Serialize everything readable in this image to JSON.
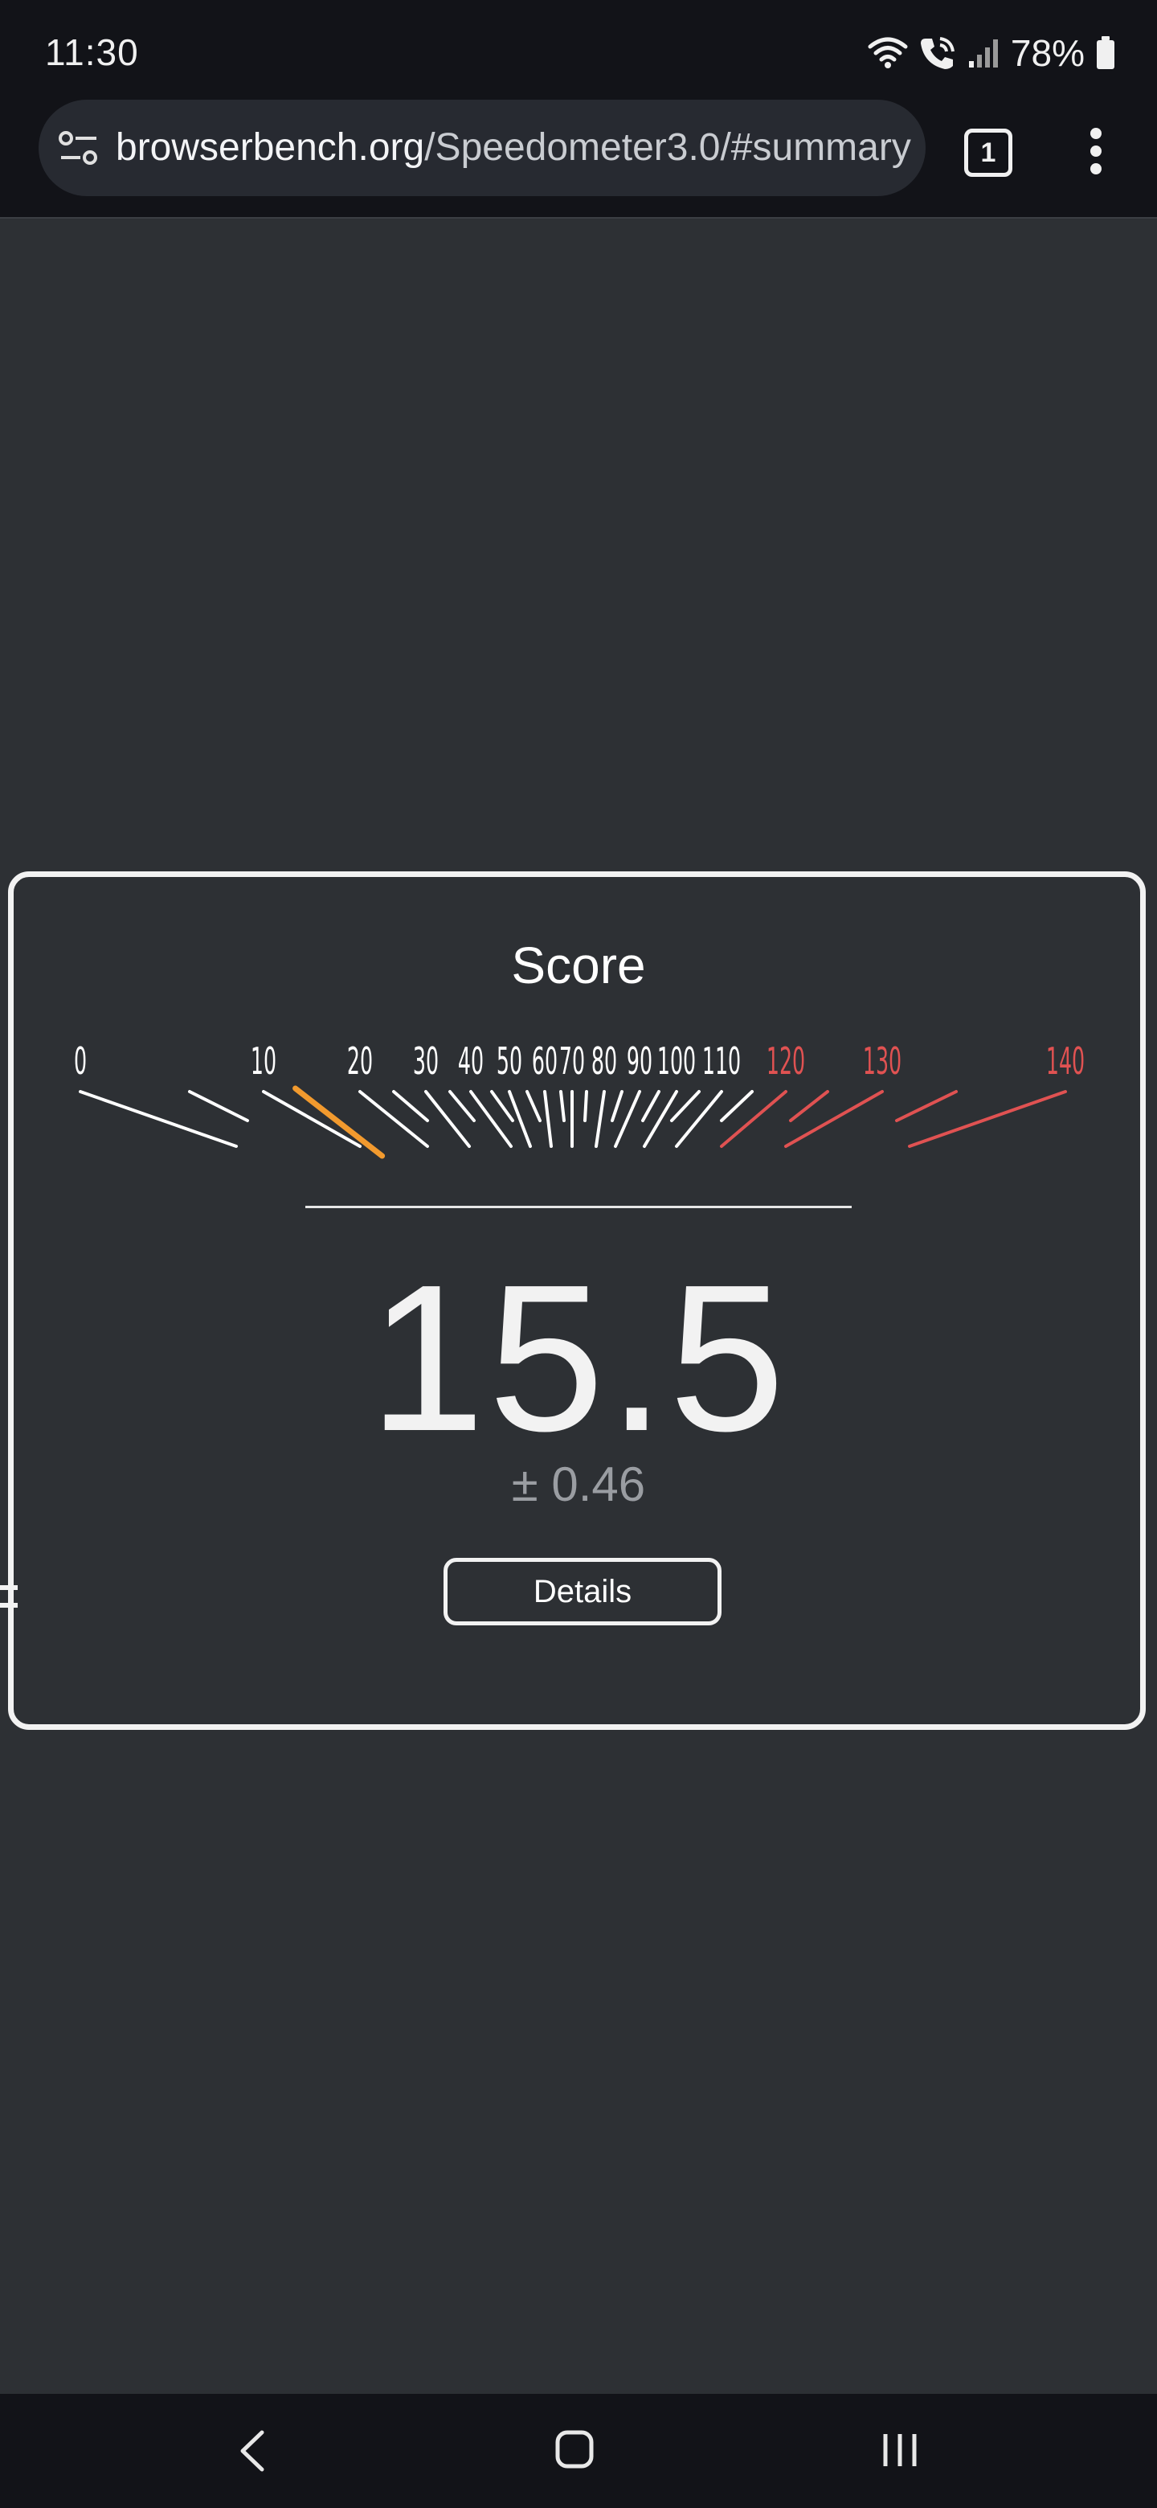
{
  "status_bar": {
    "time": "11:30",
    "battery": "78%",
    "icons": [
      "wifi-icon",
      "wifi-calling-icon",
      "signal-icon",
      "battery-icon"
    ]
  },
  "browser": {
    "url_host": "browserbench.org",
    "url_path": "/Speedometer3.0/#summary",
    "tab_count": "1",
    "icons": [
      "site-info-icon",
      "tab-switcher-icon",
      "menu-dots-icon"
    ]
  },
  "score_card": {
    "title": "Score",
    "score": "15.5",
    "error": "± 0.46",
    "details_label": "Details"
  },
  "gauge": {
    "needle_value": 15.5,
    "tick_labels": [
      {
        "text": "0",
        "color": "#ffffff"
      },
      {
        "text": "10",
        "color": "#ffffff"
      },
      {
        "text": "20",
        "color": "#ffffff"
      },
      {
        "text": "30",
        "color": "#ffffff"
      },
      {
        "text": "40",
        "color": "#ffffff"
      },
      {
        "text": "50",
        "color": "#ffffff"
      },
      {
        "text": "60",
        "color": "#ffffff"
      },
      {
        "text": "70",
        "color": "#ffffff"
      },
      {
        "text": "80",
        "color": "#ffffff"
      },
      {
        "text": "90",
        "color": "#ffffff"
      },
      {
        "text": "100",
        "color": "#ffffff"
      },
      {
        "text": "110",
        "color": "#ffffff"
      },
      {
        "text": "120",
        "color": "#e05252"
      },
      {
        "text": "130",
        "color": "#e05252"
      },
      {
        "text": "140",
        "color": "#e05252"
      }
    ],
    "needle_color": "#f29a2e",
    "redline_color": "#e05252"
  },
  "nav_bar": {
    "icons": [
      "back-icon",
      "home-icon",
      "recents-icon"
    ]
  }
}
